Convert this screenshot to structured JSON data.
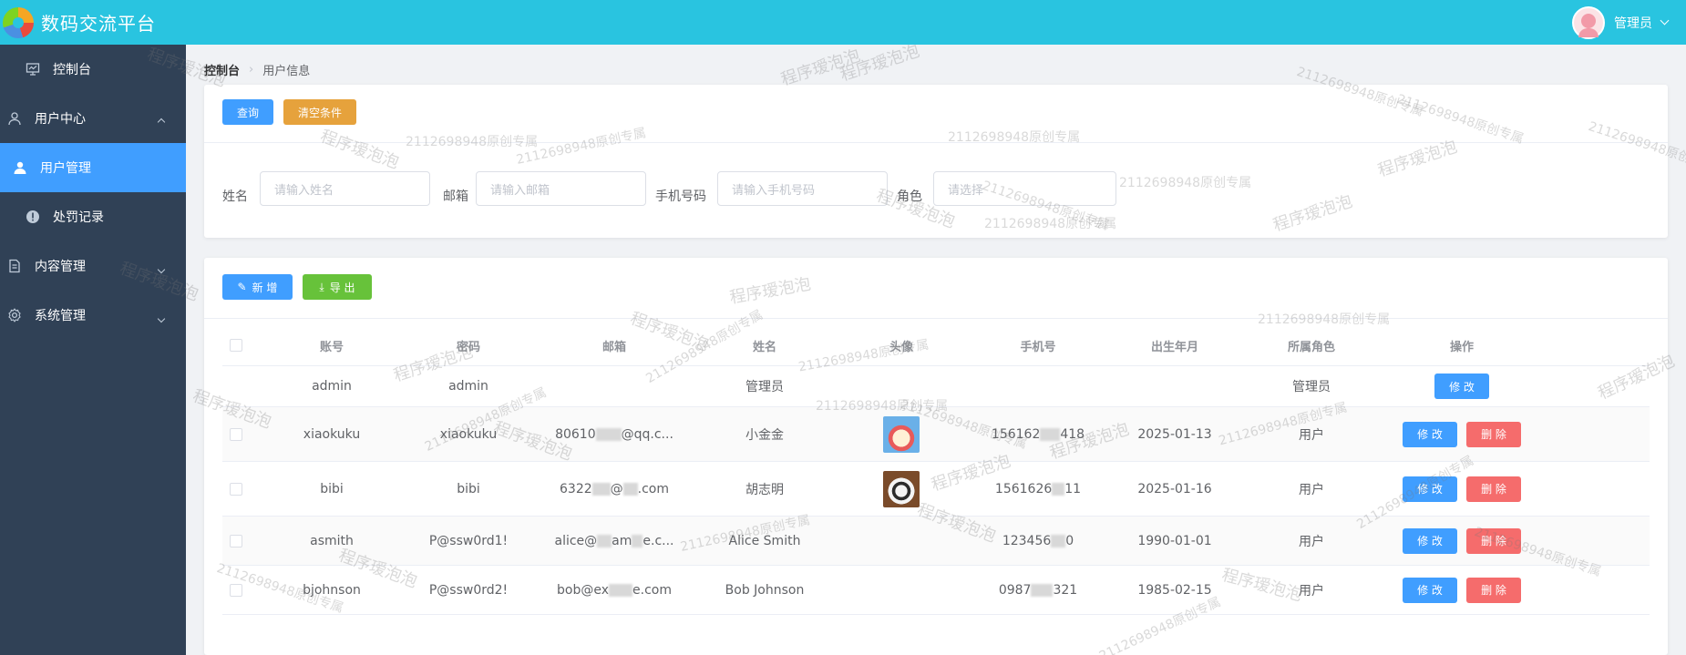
{
  "header": {
    "app_title": "数码交流平台",
    "user_label": "管理员"
  },
  "sidebar": {
    "items": [
      {
        "label": "控制台",
        "icon": "dashboard-icon"
      },
      {
        "label": "用户中心",
        "icon": "user-icon"
      },
      {
        "label": "用户管理",
        "icon": "user-filled-icon"
      },
      {
        "label": "处罚记录",
        "icon": "warning-icon"
      },
      {
        "label": "内容管理",
        "icon": "document-icon"
      },
      {
        "label": "系统管理",
        "icon": "gear-icon"
      }
    ]
  },
  "breadcrumb": {
    "root": "控制台",
    "current": "用户信息"
  },
  "search_card": {
    "query_button": "查询",
    "reset_button": "清空条件",
    "fields": [
      {
        "label": "姓名",
        "placeholder": "请输入姓名"
      },
      {
        "label": "邮箱",
        "placeholder": "请输入邮箱"
      },
      {
        "label": "手机号码",
        "placeholder": "请输入手机号码"
      },
      {
        "label": "角色",
        "placeholder": "请选择"
      }
    ]
  },
  "toolbar": {
    "add_button": "新 增",
    "export_button": "导 出"
  },
  "table": {
    "columns": [
      "账号",
      "密码",
      "邮箱",
      "姓名",
      "头像",
      "手机号",
      "出生年月",
      "所属角色",
      "操作"
    ],
    "edit_label": "修 改",
    "delete_label": "删 除",
    "rows": [
      {
        "account": "admin",
        "password": "admin",
        "email": "",
        "name": "管理员",
        "avatar": "",
        "phone": "",
        "birth": "",
        "role": "管理员"
      },
      {
        "account": "xiaokuku",
        "password": "xiaokuku",
        "email": "80610",
        "email_tail": "@qq.c...",
        "name": "小金金",
        "avatar": "cartoon",
        "phone": "156162",
        "phone_tail": "418",
        "birth": "2025-01-13",
        "role": "用户"
      },
      {
        "account": "bibi",
        "password": "bibi",
        "email": "6322",
        "email_tail": "@",
        "email_end": ".com",
        "name": "胡志明",
        "avatar": "panda",
        "phone": "1561626",
        "phone_tail": "11",
        "birth": "2025-01-16",
        "role": "用户"
      },
      {
        "account": "asmith",
        "password": "P@ssw0rd1!",
        "email": "alice@",
        "email_tail": "am",
        "email_end": "e.c...",
        "name": "Alice Smith",
        "avatar": "",
        "phone": "123456",
        "phone_tail": "0",
        "birth": "1990-01-01",
        "role": "用户"
      },
      {
        "account": "bjohnson",
        "password": "P@ssw0rd2!",
        "email": "bob@ex",
        "email_tail": "e.com",
        "name": "Bob Johnson",
        "avatar": "",
        "phone": "0987",
        "phone_tail": "321",
        "birth": "1985-02-15",
        "role": "用户"
      }
    ]
  },
  "watermark": {
    "text_a": "程序瑷泡泡",
    "text_b": "2112698948原创专属"
  }
}
